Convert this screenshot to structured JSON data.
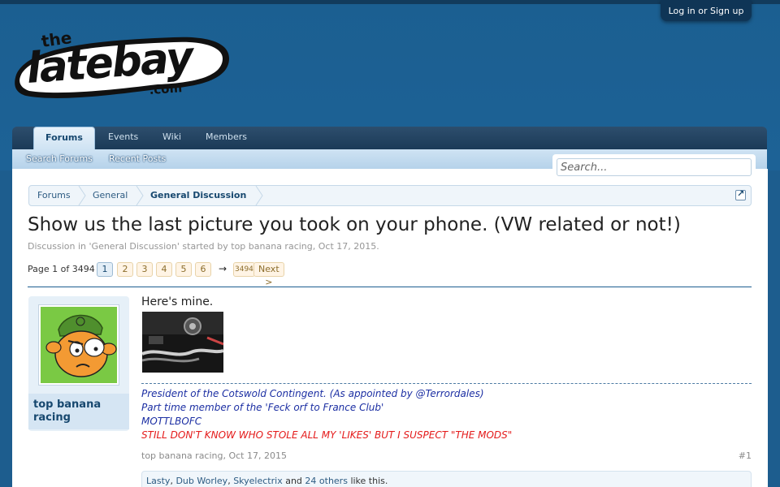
{
  "header": {
    "login_label": "Log in or Sign up",
    "logo_text": "thelatebay.com"
  },
  "nav": {
    "tabs": [
      "Forums",
      "Events",
      "Wiki",
      "Members"
    ],
    "active_tab": "Forums",
    "subnav": [
      "Search Forums",
      "Recent Posts"
    ],
    "search_placeholder": "Search..."
  },
  "breadcrumb": [
    "Forums",
    "General",
    "General Discussion"
  ],
  "thread": {
    "title": "Show us the last picture you took on your phone. (VW related or not!)",
    "meta": "Discussion in 'General Discussion' started by top banana racing, Oct 17, 2015."
  },
  "pagination": {
    "label": "Page 1 of 3494",
    "pages": [
      "1",
      "2",
      "3",
      "4",
      "5",
      "6"
    ],
    "current": "1",
    "arrow": "→",
    "last": "3494",
    "next_label": "Next >"
  },
  "post": {
    "username": "top banana racing",
    "message": "Here's mine.",
    "signature": [
      {
        "text": "President of the Cotswold Contingent. (As appointed by @Terrordales)",
        "color": "#1c2fa3"
      },
      {
        "text": "Part time member of the 'Feck orf to France Club'",
        "color": "#1c2fa3"
      },
      {
        "text": "MOTTLBOFC",
        "color": "#1c2fa3"
      },
      {
        "text": "STILL DON'T KNOW WHO STOLE ALL MY 'LIKES' BUT I SUSPECT \"THE MODS\"",
        "color": "#e41a1a"
      }
    ],
    "meta": "top banana racing, Oct 17, 2015",
    "number": "#1",
    "likes": {
      "user1": "Lasty",
      "sep1": ",",
      "user2": "Dub Worley",
      "sep2": ",",
      "user3": "Skyelectrix",
      "and": "and",
      "others": "24 others",
      "suffix": "like this."
    }
  },
  "colors": {
    "header_blue": "#1d6296",
    "link_blue": "#2d5b82",
    "sig_blue": "#1c2fa3",
    "sig_red": "#e41a1a"
  }
}
